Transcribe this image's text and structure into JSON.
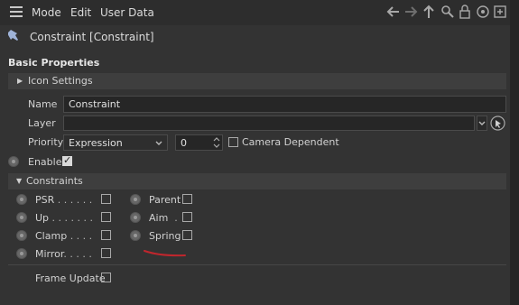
{
  "menu": {
    "items": [
      "Mode",
      "Edit",
      "User Data"
    ]
  },
  "toolbar_icons": [
    "arrow-left-icon",
    "arrow-right-icon",
    "arrow-up-icon",
    "search-icon",
    "lock-icon",
    "target-icon",
    "add-icon"
  ],
  "object": {
    "title": "Constraint [Constraint]"
  },
  "basic": {
    "heading": "Basic Properties",
    "icon_settings": "Icon Settings",
    "name_label": "Name",
    "name_value": "Constraint",
    "layer_label": "Layer",
    "layer_value": "",
    "priority_label": "Priority",
    "priority_value": "Expression",
    "priority_number": "0",
    "camera_dependent_label": "Camera Dependent",
    "camera_dependent_checked": false,
    "enable_label": "Enable",
    "enable_checked": true
  },
  "constraints": {
    "heading": "Constraints",
    "left": [
      {
        "label": "PSR",
        "dots": ". . . . . .",
        "checked": false
      },
      {
        "label": "Up",
        "dots": ". . . . . . .",
        "checked": false
      },
      {
        "label": "Clamp",
        "dots": ". . . .",
        "checked": false
      },
      {
        "label": "Mirror",
        "dots": ". . . . .",
        "checked": false
      }
    ],
    "right": [
      {
        "label": "Parent",
        "dots": "",
        "checked": false
      },
      {
        "label": "Aim",
        "dots": ".",
        "checked": false
      },
      {
        "label": "Spring",
        "dots": "",
        "checked": false
      }
    ],
    "frame_update_label": "Frame Update",
    "frame_update_checked": false
  },
  "colors": {
    "annotation_red": "#c0262d",
    "panel_bg": "#333333",
    "field_bg": "#262626"
  }
}
